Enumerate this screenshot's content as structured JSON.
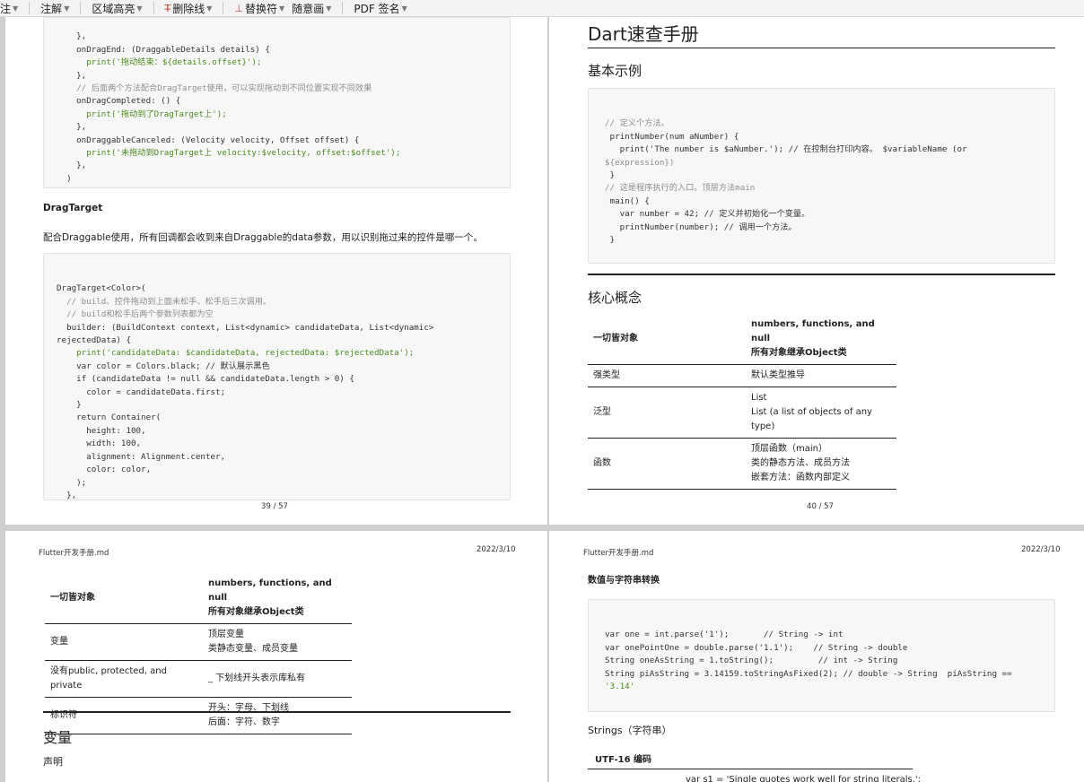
{
  "toolbar": {
    "items": [
      "注",
      "注解",
      "区域高亮",
      "删除线",
      "替换符",
      "随意画",
      "PDF 签名"
    ]
  },
  "pages": {
    "p39": {
      "code_top": [
        "    },",
        "    onDragEnd: (DraggableDetails details) {",
        "      print('拖动结束：${details.offset}');",
        "    },",
        "    // 后面两个方法配合DragTarget使用，可以实现拖动到不同位置实现不同效果",
        "    onDragCompleted: () {",
        "      print('拖动到了DragTarget上');",
        "    },",
        "    onDraggableCanceled: (Velocity velocity, Offset offset) {",
        "      print('未拖动到DragTarget上 velocity:$velocity, offset:$offset');",
        "    },",
        "  )"
      ],
      "heading": "DragTarget",
      "paragraph": "配合Draggable使用，所有回调都会收到来自Draggable的data参数，用以识别拖过来的控件是哪一个。",
      "code_main": [
        "DragTarget<Color>(",
        "  // build、控件拖动到上面未松手、松手后三次调用。",
        "  // build和松手后两个参数列表都为空",
        "  builder: (BuildContext context, List<dynamic> candidateData, List<dynamic>",
        "rejectedData) {",
        "    print('candidateData: $candidateData, rejectedData: $rejectedData');",
        "    var color = Colors.black; // 默认展示黑色",
        "    if (candidateData != null && candidateData.length > 0) {",
        "      color = candidateData.first;",
        "    }",
        "    return Container(",
        "      height: 100,",
        "      width: 100,",
        "      alignment: Alignment.center,",
        "      color: color,",
        "    );",
        "  },"
      ],
      "page_number": "39 / 57"
    },
    "p40": {
      "title": "Dart速查手册",
      "section1": "基本示例",
      "code": [
        "// 定义个方法。",
        " printNumber(num aNumber) {",
        "   print('The number is $aNumber.'); // 在控制台打印内容。 $variableName (or",
        "${expression})",
        " }",
        "",
        "// 这是程序执行的入口。顶层方法main",
        " main() {",
        "   var number = 42; // 定义并初始化一个变量。",
        "   printNumber(number); // 调用一个方法。",
        " }"
      ],
      "section2": "核心概念",
      "table": {
        "header": [
          "一切皆对象",
          "numbers, functions, and null",
          "所有对象继承Object类"
        ],
        "rows": [
          {
            "label": "强类型",
            "lines": [
              "默认类型推导"
            ]
          },
          {
            "label": "泛型",
            "lines": [
              "List",
              "List (a list of objects of any type)"
            ]
          },
          {
            "label": "函数",
            "lines": [
              "顶层函数（main）",
              "类的静态方法、成员方法",
              "嵌套方法：函数内部定义"
            ]
          }
        ]
      },
      "page_number": "40 / 57"
    },
    "p41": {
      "header_left": "Flutter开发手册.md",
      "header_right": "2022/3/10",
      "table": {
        "header": [
          "一切皆对象",
          "numbers, functions, and null",
          "所有对象继承Object类"
        ],
        "rows": [
          {
            "label": "变量",
            "lines": [
              "顶层变量",
              "类静态变量、成员变量"
            ]
          },
          {
            "label": "没有public, protected, and private",
            "lines": [
              "_ 下划线开头表示库私有"
            ]
          },
          {
            "label": "标识符",
            "lines": [
              "开头：字母、下划线",
              "后面：字符、数字"
            ]
          }
        ]
      },
      "section": "变量",
      "subsection": "声明"
    },
    "p42": {
      "header_left": "Flutter开发手册.md",
      "header_right": "2022/3/10",
      "heading": "数值与字符串转换",
      "code": [
        "var one = int.parse('1');       // String -> int",
        "var onePointOne = double.parse('1.1');    // String -> double",
        "",
        "String oneAsString = 1.toString();         // int -> String",
        "String piAsString = 3.14159.toStringAsFixed(2); // double -> String  piAsString ==",
        "'3.14'"
      ],
      "strings_heading": "Strings（字符串）",
      "utf_heading": "UTF-16 编码",
      "cut_line": "var s1 = 'Single quotes work well for string literals.';"
    }
  }
}
